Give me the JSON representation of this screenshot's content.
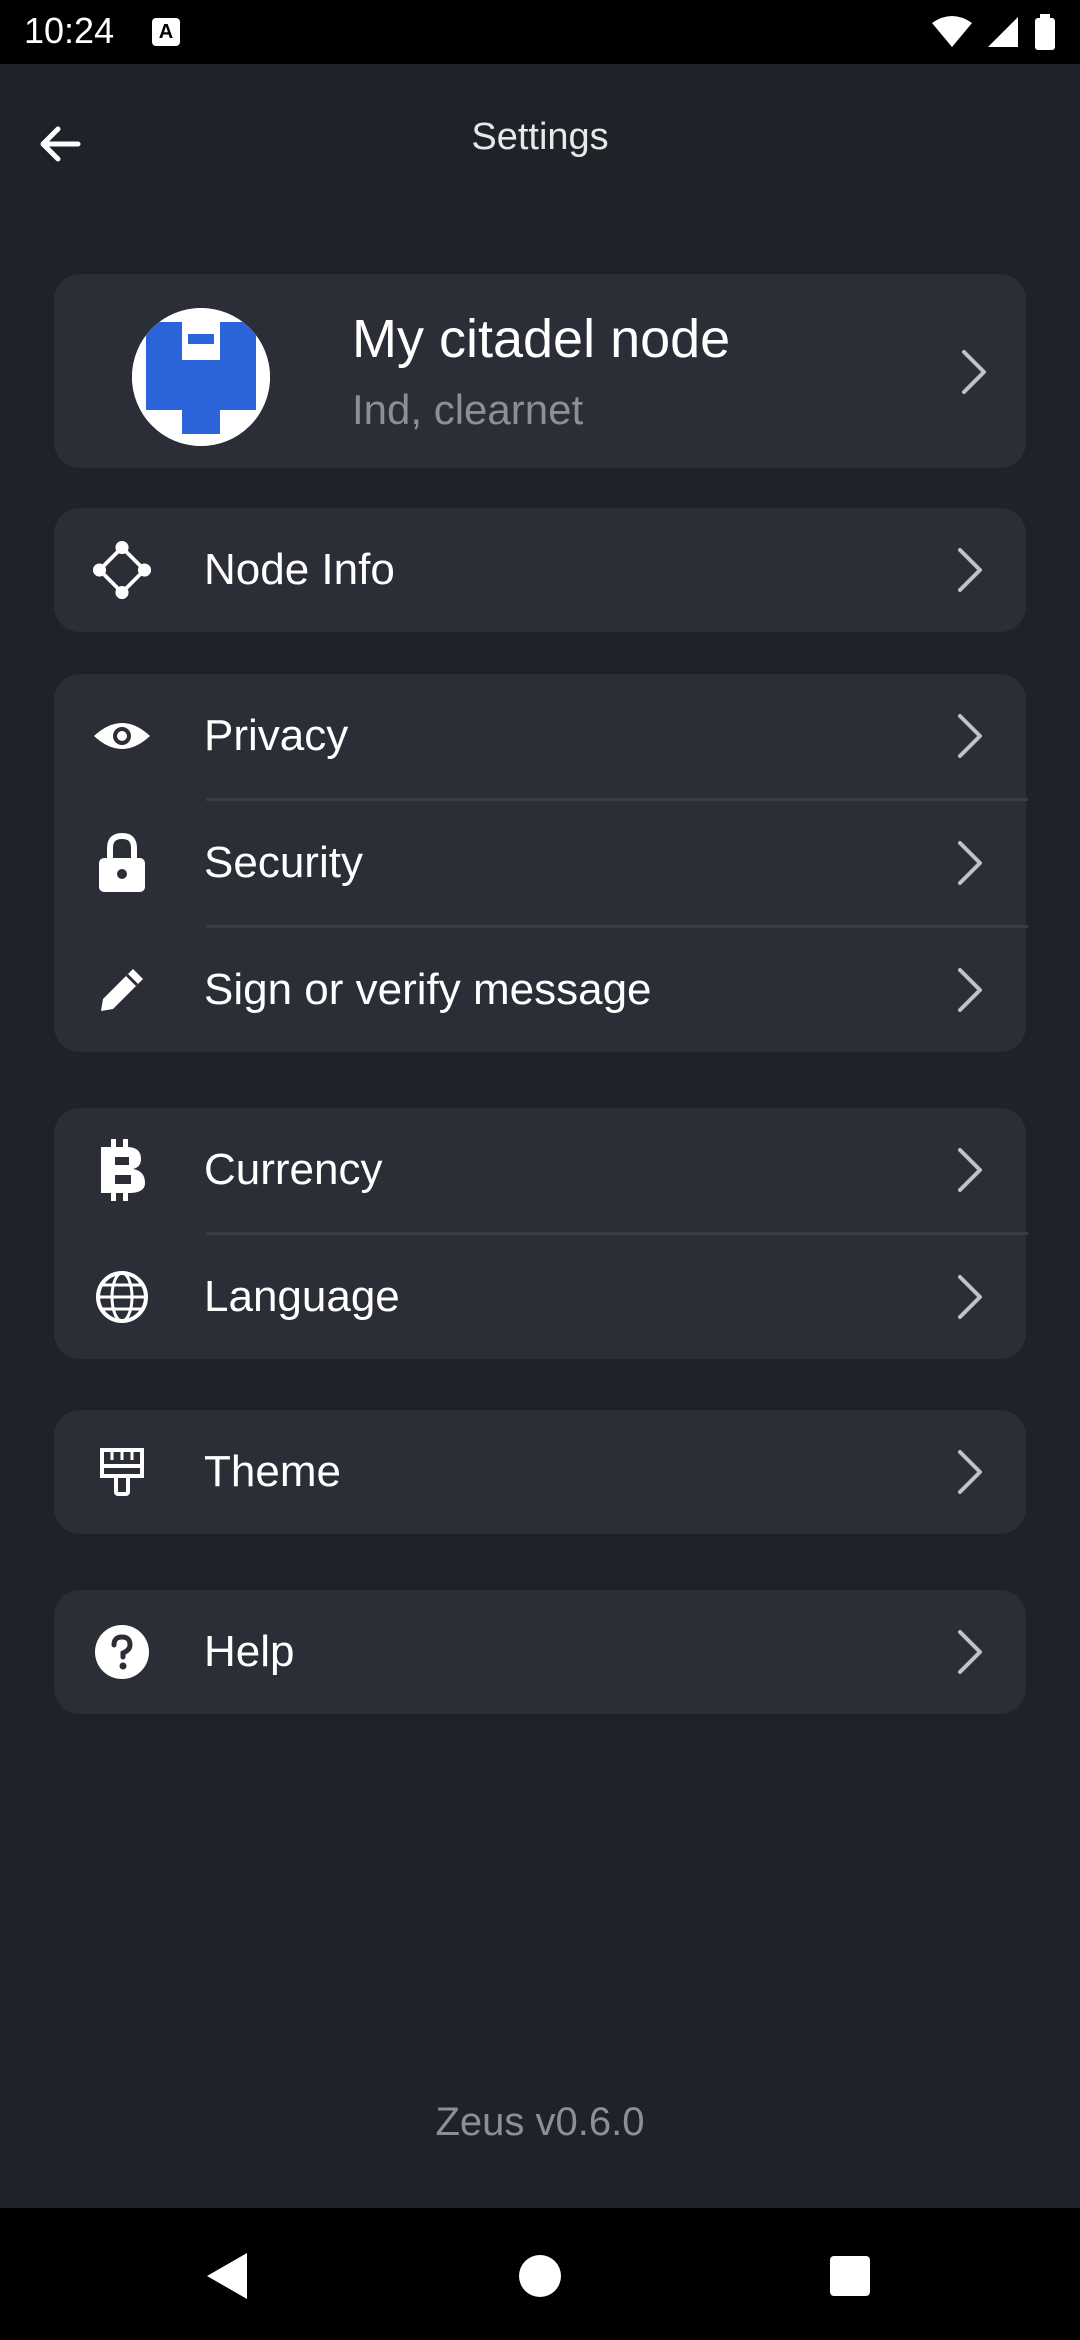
{
  "status_bar": {
    "time": "10:24",
    "notification_icon": "a-box-icon",
    "icons": [
      "wifi-icon",
      "signal-icon",
      "battery-icon"
    ]
  },
  "header": {
    "title": "Settings",
    "back_icon": "arrow-left-icon"
  },
  "node": {
    "name": "My citadel node",
    "subtitle": "Ind, clearnet",
    "avatar_icon": "citadel-logo-icon"
  },
  "groups": [
    {
      "items": [
        {
          "label": "Node Info",
          "icon": "node-graph-icon"
        }
      ]
    },
    {
      "items": [
        {
          "label": "Privacy",
          "icon": "eye-icon"
        },
        {
          "label": "Security",
          "icon": "lock-icon"
        },
        {
          "label": "Sign or verify message",
          "icon": "pencil-icon"
        }
      ]
    },
    {
      "items": [
        {
          "label": "Currency",
          "icon": "bitcoin-icon"
        },
        {
          "label": "Language",
          "icon": "globe-icon"
        }
      ]
    },
    {
      "items": [
        {
          "label": "Theme",
          "icon": "paint-brush-icon"
        }
      ]
    },
    {
      "items": [
        {
          "label": "Help",
          "icon": "help-circle-icon"
        }
      ]
    }
  ],
  "footer": {
    "version": "Zeus v0.6.0"
  },
  "colors": {
    "background": "#1f2228",
    "card": "#2b2e36",
    "text": "#ffffff",
    "muted_text": "#8c8f96",
    "avatar_blue": "#2b63d9"
  },
  "nav": {
    "icons": [
      "back-triangle-icon",
      "home-circle-icon",
      "recents-square-icon"
    ]
  }
}
